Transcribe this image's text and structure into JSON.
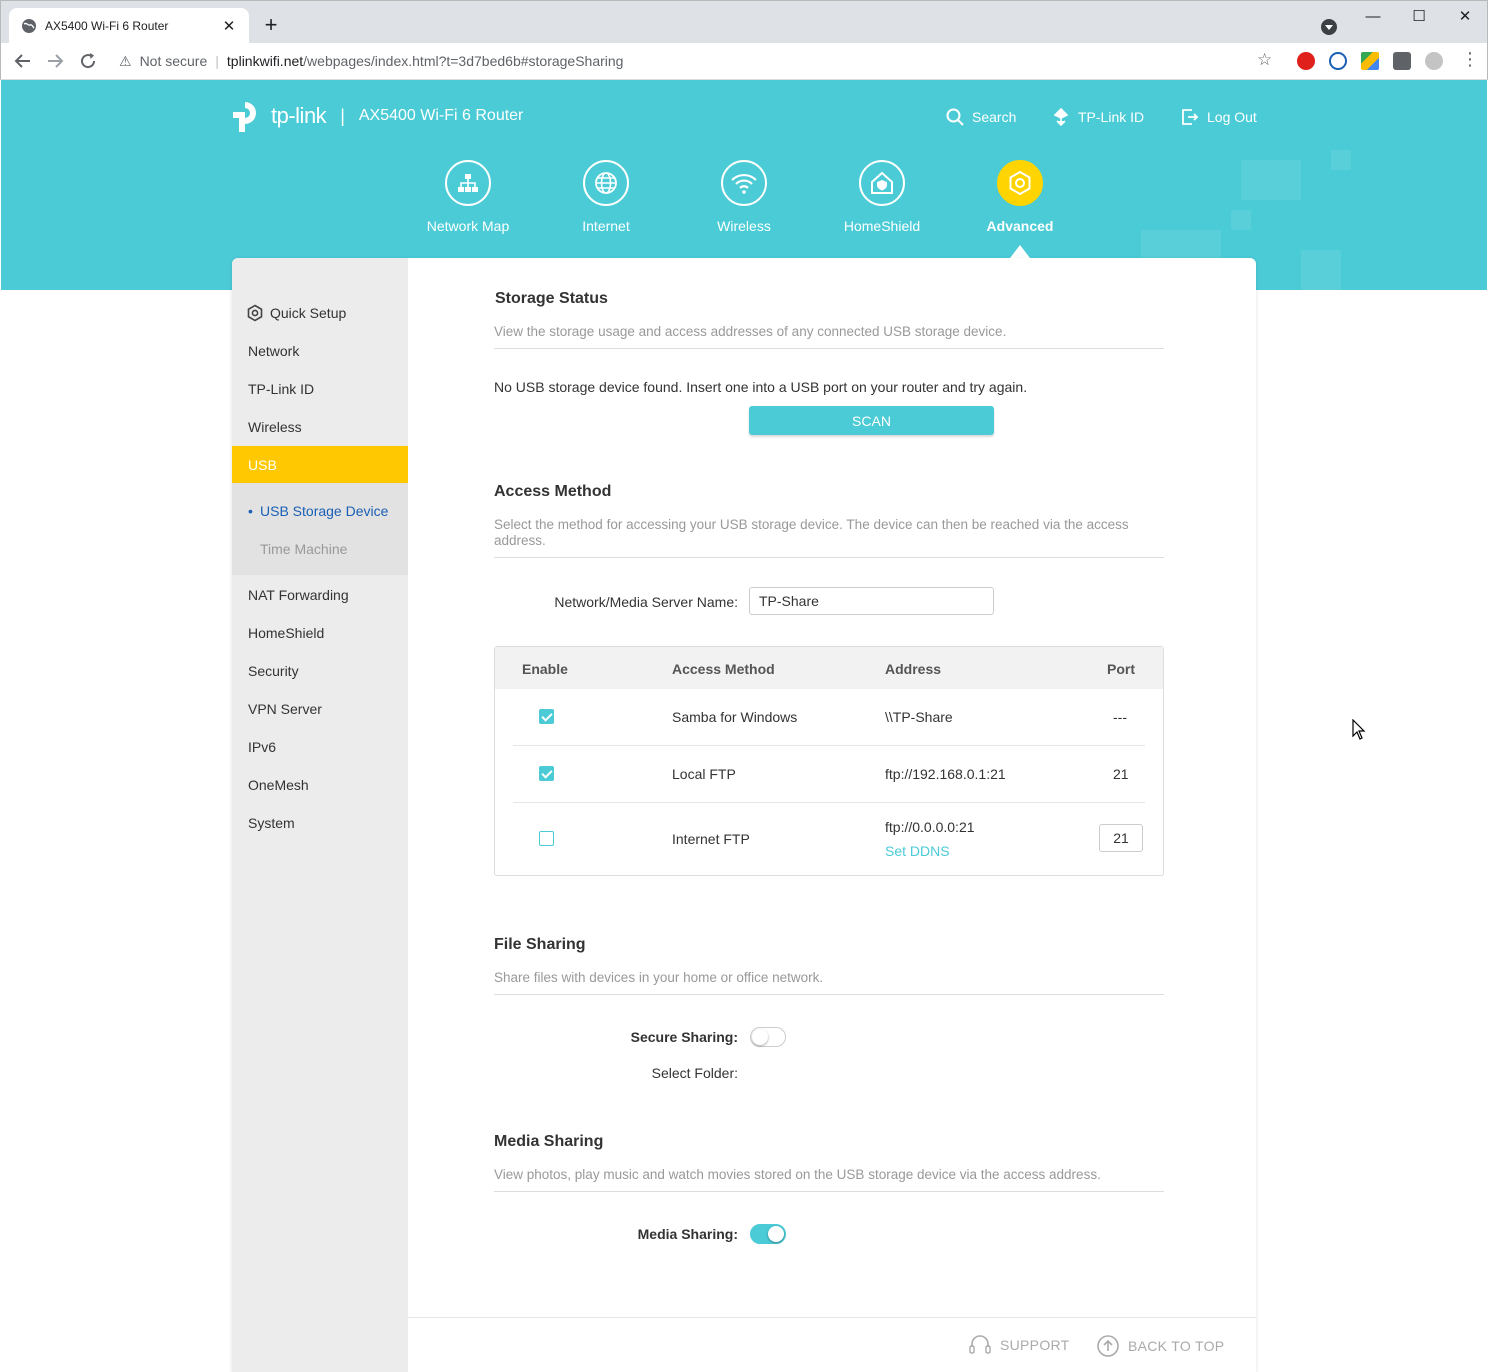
{
  "browser": {
    "tab_title": "AX5400 Wi-Fi 6 Router",
    "tab_close": "✕",
    "new_tab": "+",
    "security_label": "Not secure",
    "url_host": "tplinkwifi.net",
    "url_path": "/webpages/index.html?t=3d7bed6b#storageSharing",
    "window": {
      "minimize": "—",
      "maximize": "☐",
      "close": "✕"
    }
  },
  "header": {
    "brand": "tp-link",
    "divider": "|",
    "product": "AX5400 Wi-Fi 6 Router",
    "links": {
      "search": "Search",
      "tplink_id": "TP-Link ID",
      "logout": "Log Out"
    }
  },
  "main_nav": [
    {
      "label": "Network Map",
      "icon": "network-map-icon"
    },
    {
      "label": "Internet",
      "icon": "globe-icon"
    },
    {
      "label": "Wireless",
      "icon": "wifi-icon"
    },
    {
      "label": "HomeShield",
      "icon": "homeshield-icon"
    },
    {
      "label": "Advanced",
      "icon": "gear-icon",
      "active": true
    }
  ],
  "sidebar": {
    "items": [
      {
        "label": "Quick Setup"
      },
      {
        "label": "Network"
      },
      {
        "label": "TP-Link ID"
      },
      {
        "label": "Wireless"
      },
      {
        "label": "USB",
        "active": true
      },
      {
        "label": "NAT Forwarding"
      },
      {
        "label": "HomeShield"
      },
      {
        "label": "Security"
      },
      {
        "label": "VPN Server"
      },
      {
        "label": "IPv6"
      },
      {
        "label": "OneMesh"
      },
      {
        "label": "System"
      }
    ],
    "usb_sub": [
      {
        "label": "USB Storage Device",
        "active": true
      },
      {
        "label": "Time Machine"
      }
    ]
  },
  "storage_status": {
    "title": "Storage Status",
    "desc": "View the storage usage and access addresses of any connected USB storage device.",
    "message": "No USB storage device found. Insert one into a USB port on your router and try again.",
    "scan_label": "SCAN"
  },
  "access_method": {
    "title": "Access Method",
    "desc": "Select the method for accessing your USB storage device. The device can then be reached via the access address.",
    "server_name_label": "Network/Media Server Name:",
    "server_name_value": "TP-Share",
    "columns": [
      "Enable",
      "Access Method",
      "Address",
      "Port"
    ],
    "rows": [
      {
        "enabled": true,
        "method": "Samba for Windows",
        "address": "\\\\TP-Share",
        "port": "---"
      },
      {
        "enabled": true,
        "method": "Local FTP",
        "address": "ftp://192.168.0.1:21",
        "port": "21"
      },
      {
        "enabled": false,
        "method": "Internet FTP",
        "address": "ftp://0.0.0.0:21",
        "address_link": "Set DDNS",
        "port": "21"
      }
    ]
  },
  "file_sharing": {
    "title": "File Sharing",
    "desc": "Share files with devices in your home or office network.",
    "secure_label": "Secure Sharing:",
    "secure_on": false,
    "folder_label": "Select Folder:"
  },
  "media_sharing": {
    "title": "Media Sharing",
    "desc": "View photos, play music and watch movies stored on the USB storage device via the access address.",
    "toggle_label": "Media Sharing:",
    "toggle_on": true
  },
  "footer": {
    "support": "SUPPORT",
    "back_to_top": "BACK TO TOP"
  },
  "colors": {
    "accent": "#4acbd6",
    "active_yellow": "#ffc800"
  }
}
